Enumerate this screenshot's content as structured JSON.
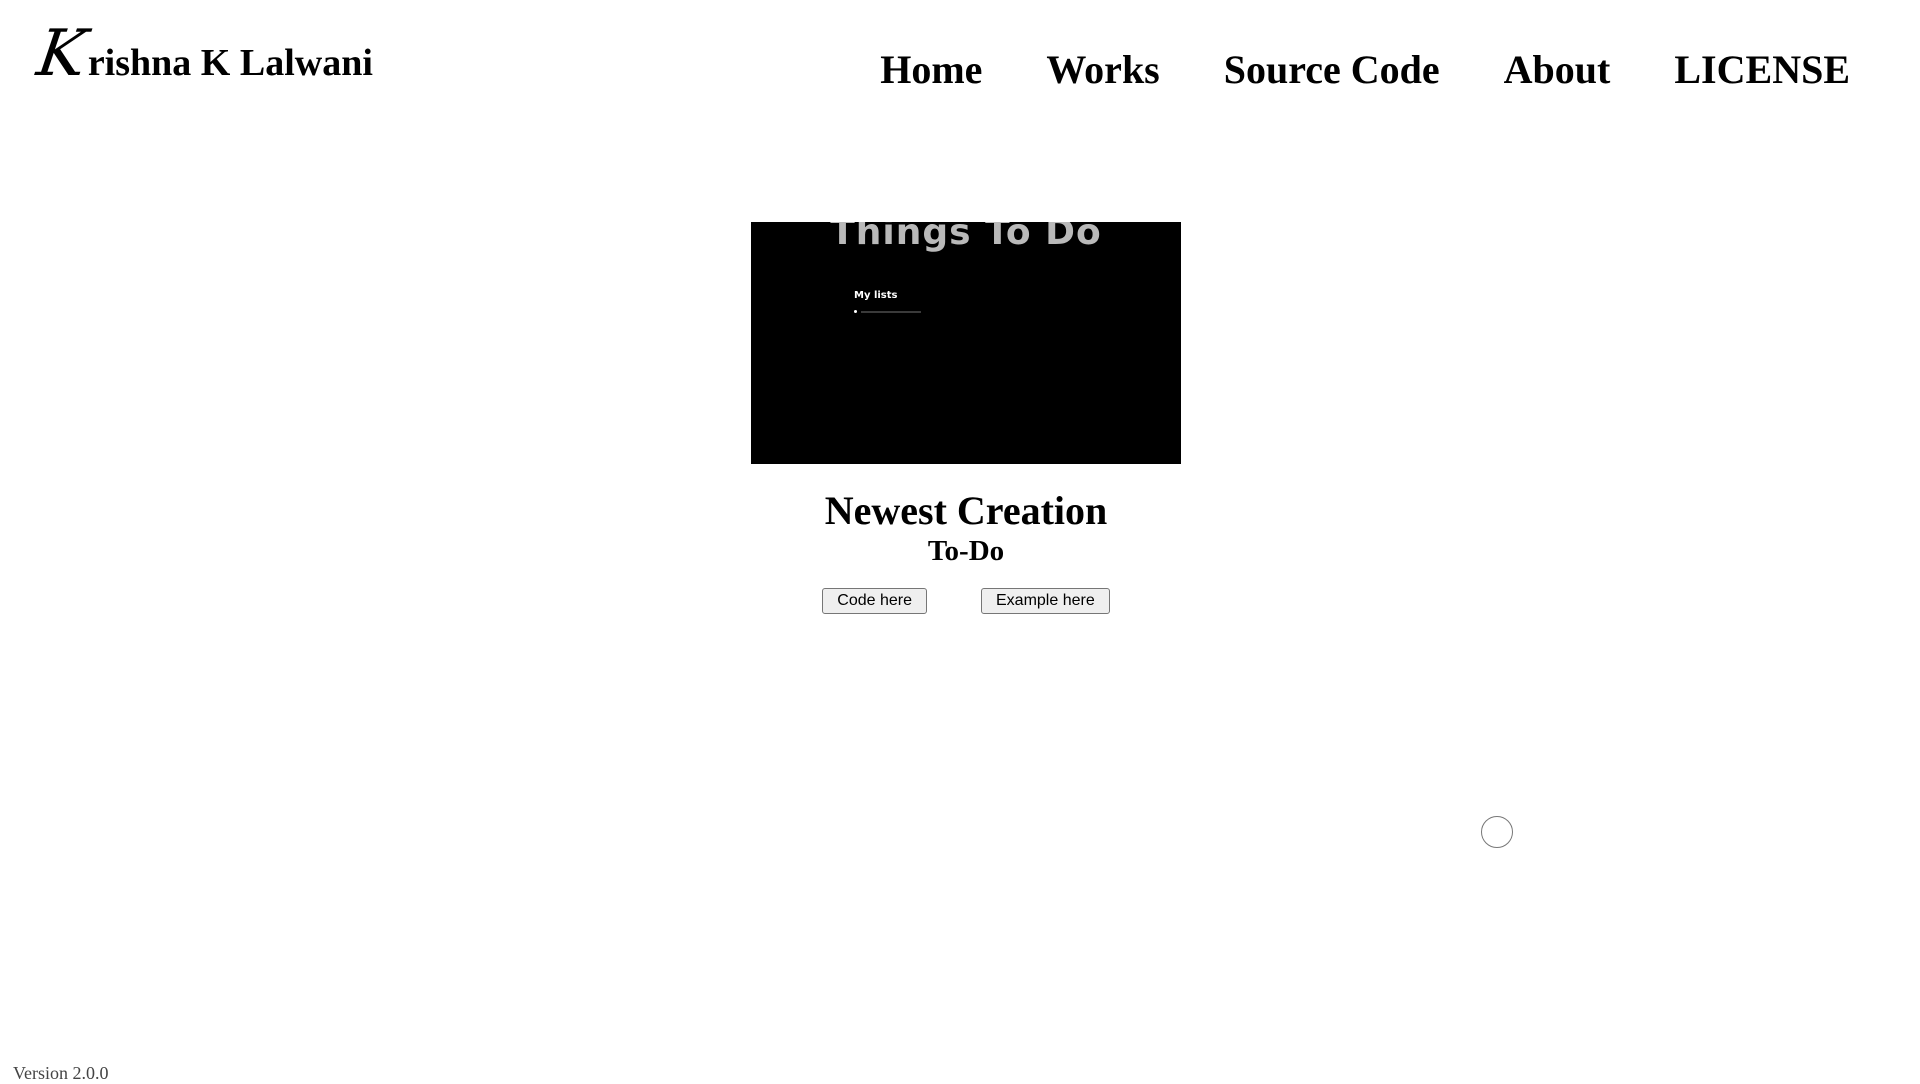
{
  "header": {
    "logo_initial": "K",
    "logo_rest": "rishna K Lalwani",
    "nav": [
      {
        "label": "Home"
      },
      {
        "label": "Works"
      },
      {
        "label": "Source Code"
      },
      {
        "label": "About"
      },
      {
        "label": "LICENSE"
      }
    ]
  },
  "main": {
    "preview": {
      "title": "Things To Do",
      "lists_label": "My lists"
    },
    "heading": "Newest Creation",
    "subheading": "To-Do",
    "code_button": "Code here",
    "example_button": "Example here"
  },
  "footer": {
    "version": "Version 2.0.0"
  }
}
